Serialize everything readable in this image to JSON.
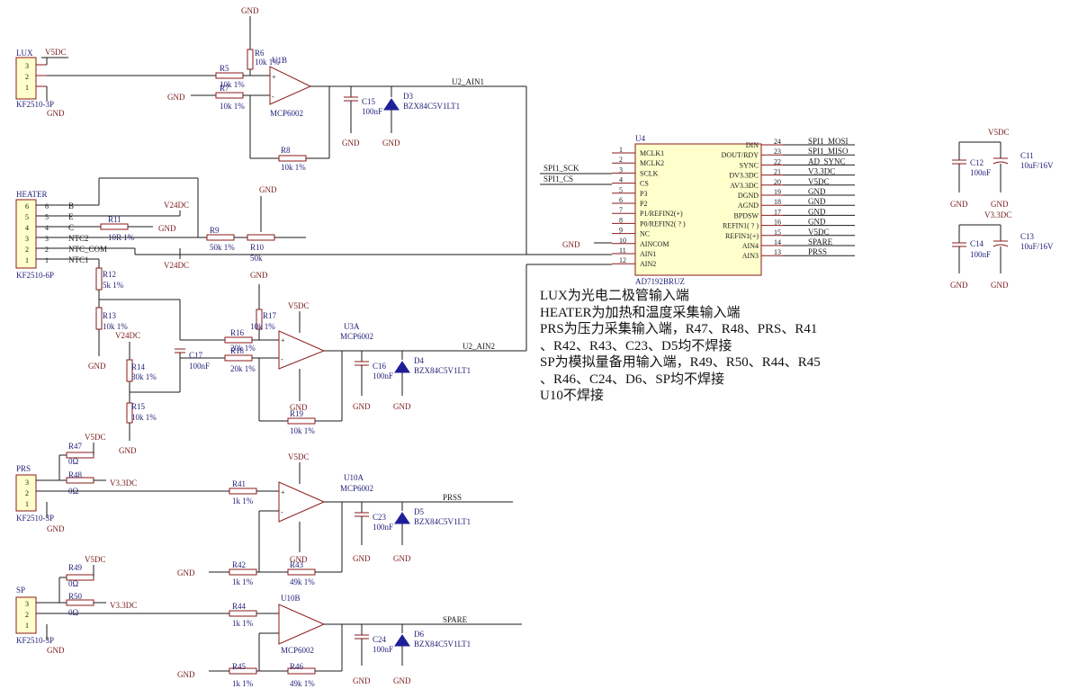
{
  "net_labels": {
    "gnd": "GND",
    "v5": "V5DC",
    "v33": "V3.3DC",
    "v24": "V24DC",
    "u2_ain1": "U2_AIN1",
    "u2_ain2": "U2_AIN2",
    "prss": "PRSS",
    "spare": "SPARE",
    "spi_sck": "SPI1_SCK",
    "spi_cs": "SPI1_CS",
    "spi_mosi": "SPI1_MOSI",
    "spi_miso": "SPI1_MISO",
    "ad_sync": "AD_SYNC",
    "spare_pin": "SPARE",
    "prss_pin": "PRSS"
  },
  "connectors": {
    "lux": {
      "name": "LUX",
      "part": "KF2510-3P",
      "pins": [
        "3",
        "2",
        "1"
      ]
    },
    "heater": {
      "name": "HEATER",
      "part": "KF2510-6P",
      "pins": [
        "6",
        "5",
        "4",
        "3",
        "2",
        "1"
      ],
      "nets": [
        "B",
        "E",
        "C",
        "NTC2",
        "NTC_COM",
        "NTC1"
      ]
    },
    "prs": {
      "name": "PRS",
      "part": "KF2510-3P",
      "pins": [
        "3",
        "2",
        "1"
      ]
    },
    "sp": {
      "name": "SP",
      "part": "KF2510-3P",
      "pins": [
        "3",
        "2",
        "1"
      ]
    }
  },
  "resistors": {
    "r5": {
      "ref": "R5",
      "val": "10k 1%"
    },
    "r6": {
      "ref": "R6",
      "val": "10k 1%"
    },
    "r7": {
      "ref": "R7",
      "val": "10k 1%"
    },
    "r8": {
      "ref": "R8",
      "val": "10k 1%"
    },
    "r9": {
      "ref": "R9",
      "val": "50k 1%"
    },
    "r10": {
      "ref": "R10",
      "val": "50k"
    },
    "r11": {
      "ref": "R11",
      "val": "10R 1%"
    },
    "r12": {
      "ref": "R12",
      "val": "5k 1%"
    },
    "r13": {
      "ref": "R13",
      "val": "10k 1%"
    },
    "r14": {
      "ref": "R14",
      "val": "30k 1%"
    },
    "r15": {
      "ref": "R15",
      "val": "10k 1%"
    },
    "r16": {
      "ref": "R16",
      "val": "20k 1%"
    },
    "r17": {
      "ref": "R17",
      "val": "10k 1%"
    },
    "r18": {
      "ref": "R18",
      "val": "20k 1%"
    },
    "r19": {
      "ref": "R19",
      "val": "10k 1%"
    },
    "r41": {
      "ref": "R41",
      "val": "1k 1%"
    },
    "r42": {
      "ref": "R42",
      "val": "1k 1%"
    },
    "r43": {
      "ref": "R43",
      "val": "49k 1%"
    },
    "r44": {
      "ref": "R44",
      "val": "1k 1%"
    },
    "r45": {
      "ref": "R45",
      "val": "1k 1%"
    },
    "r46": {
      "ref": "R46",
      "val": "49k 1%"
    },
    "r47": {
      "ref": "R47",
      "val": "0Ω"
    },
    "r48": {
      "ref": "R48",
      "val": "0Ω"
    },
    "r49": {
      "ref": "R49",
      "val": "0Ω"
    },
    "r50": {
      "ref": "R50",
      "val": "0Ω"
    }
  },
  "capacitors": {
    "c11": {
      "ref": "C11",
      "val": "10uF/16V"
    },
    "c12": {
      "ref": "C12",
      "val": "100nF"
    },
    "c13": {
      "ref": "C13",
      "val": "10uF/16V"
    },
    "c14": {
      "ref": "C14",
      "val": "100nF"
    },
    "c15": {
      "ref": "C15",
      "val": "100nF"
    },
    "c16": {
      "ref": "C16",
      "val": "100nF"
    },
    "c17": {
      "ref": "C17",
      "val": "100nF"
    },
    "c23": {
      "ref": "C23",
      "val": "100nF"
    },
    "c24": {
      "ref": "C24",
      "val": "100nF"
    }
  },
  "diodes": {
    "d3": {
      "ref": "D3",
      "val": "BZX84C5V1LT1"
    },
    "d4": {
      "ref": "D4",
      "val": "BZX84C5V1LT1"
    },
    "d5": {
      "ref": "D5",
      "val": "BZX84C5V1LT1"
    },
    "d6": {
      "ref": "D6",
      "val": "BZX84C5V1LT1"
    }
  },
  "opamps": {
    "u1b": {
      "ref": "U1B",
      "part": "MCP6002"
    },
    "u3a": {
      "ref": "U3A",
      "part": "MCP6002"
    },
    "u10a": {
      "ref": "U10A",
      "part": "MCP6002"
    },
    "u10b": {
      "ref": "U10B",
      "part": "MCP6002"
    }
  },
  "adc": {
    "ref": "U4",
    "part": "AD7192BRUZ",
    "left_pins": [
      {
        "num": "1",
        "name": "MCLK1"
      },
      {
        "num": "2",
        "name": "MCLK2"
      },
      {
        "num": "3",
        "name": "SCLK"
      },
      {
        "num": "4",
        "name": "CS"
      },
      {
        "num": "5",
        "name": "P3"
      },
      {
        "num": "6",
        "name": "P2"
      },
      {
        "num": "7",
        "name": "P1/REFIN2(+)"
      },
      {
        "num": "8",
        "name": "P0/REFIN2( ? )"
      },
      {
        "num": "9",
        "name": "NC"
      },
      {
        "num": "10",
        "name": "AINCOM"
      },
      {
        "num": "11",
        "name": "AIN1"
      },
      {
        "num": "12",
        "name": "AIN2"
      }
    ],
    "right_pins": [
      {
        "num": "24",
        "name": "DIN"
      },
      {
        "num": "23",
        "name": "DOUT/RDY"
      },
      {
        "num": "22",
        "name": "SYNC"
      },
      {
        "num": "21",
        "name": "DV3.3DC"
      },
      {
        "num": "20",
        "name": "AV3.3DC"
      },
      {
        "num": "19",
        "name": "DGND"
      },
      {
        "num": "18",
        "name": "AGND"
      },
      {
        "num": "17",
        "name": "BPDSW"
      },
      {
        "num": "16",
        "name": "REFIN1( ? )"
      },
      {
        "num": "15",
        "name": "REFIN1(+)"
      },
      {
        "num": "14",
        "name": "AIN4"
      },
      {
        "num": "13",
        "name": "AIN3"
      }
    ],
    "right_nets": [
      "SPI1_MOSI",
      "SPI1_MISO",
      "AD_SYNC",
      "V3.3DC",
      "V5DC",
      "GND",
      "GND",
      "GND",
      "GND",
      "V5DC",
      "SPARE",
      "PRSS"
    ]
  },
  "notes": [
    "LUX为光电二极管输入端",
    "HEATER为加热和温度采集输入端",
    "PRS为压力采集输入端，R47、R48、PRS、R41",
    "、R42、R43、C23、D5均不焊接",
    "SP为模拟量备用输入端，R49、R50、R44、R45",
    "、R46、C24、D6、SP均不焊接",
    "U10不焊接"
  ],
  "colors": {
    "wire": "#1a1a1a",
    "component": "#8b1a1a",
    "ref_text": "#1f1f7a",
    "body_fill": "#ffffcc",
    "diode": "#1f1f9a"
  }
}
